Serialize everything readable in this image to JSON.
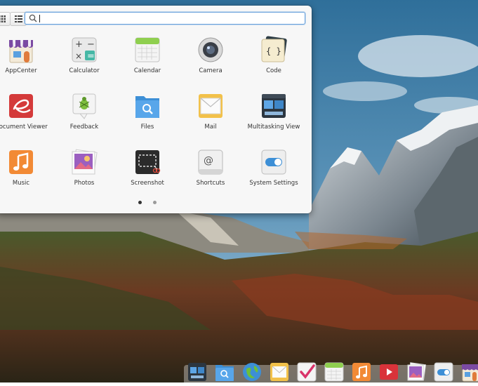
{
  "launcher": {
    "view_buttons": [
      {
        "name": "grid-view",
        "icon": "grid-view-icon",
        "active": true
      },
      {
        "name": "category-view",
        "icon": "category-view-icon",
        "active": false
      }
    ],
    "search": {
      "value": "",
      "placeholder": ""
    },
    "apps": [
      {
        "label": "AppCenter",
        "icon": "appcenter-icon"
      },
      {
        "label": "Calculator",
        "icon": "calculator-icon"
      },
      {
        "label": "Calendar",
        "icon": "calendar-icon"
      },
      {
        "label": "Camera",
        "icon": "camera-icon"
      },
      {
        "label": "Code",
        "icon": "code-icon"
      },
      {
        "label": "Document Viewer",
        "icon": "document-viewer-icon"
      },
      {
        "label": "Feedback",
        "icon": "feedback-icon"
      },
      {
        "label": "Files",
        "icon": "files-icon"
      },
      {
        "label": "Mail",
        "icon": "mail-icon"
      },
      {
        "label": "Multitasking View",
        "icon": "multitasking-view-icon"
      },
      {
        "label": "Music",
        "icon": "music-icon"
      },
      {
        "label": "Photos",
        "icon": "photos-icon"
      },
      {
        "label": "Screenshot",
        "icon": "screenshot-icon"
      },
      {
        "label": "Shortcuts",
        "icon": "shortcuts-icon"
      },
      {
        "label": "System Settings",
        "icon": "system-settings-icon"
      }
    ],
    "pages": {
      "count": 2,
      "current": 1
    }
  },
  "dock": {
    "items": [
      {
        "icon": "multitasking-view-icon"
      },
      {
        "icon": "files-icon"
      },
      {
        "icon": "web-browser-icon"
      },
      {
        "icon": "mail-icon"
      },
      {
        "icon": "tasks-icon"
      },
      {
        "icon": "calendar-icon"
      },
      {
        "icon": "music-icon"
      },
      {
        "icon": "videos-icon"
      },
      {
        "icon": "photos-icon"
      },
      {
        "icon": "system-settings-icon"
      },
      {
        "icon": "appcenter-icon"
      }
    ]
  },
  "colors": {
    "search_focus": "#6ba3dd",
    "panel_background": "#f7f7f7"
  }
}
